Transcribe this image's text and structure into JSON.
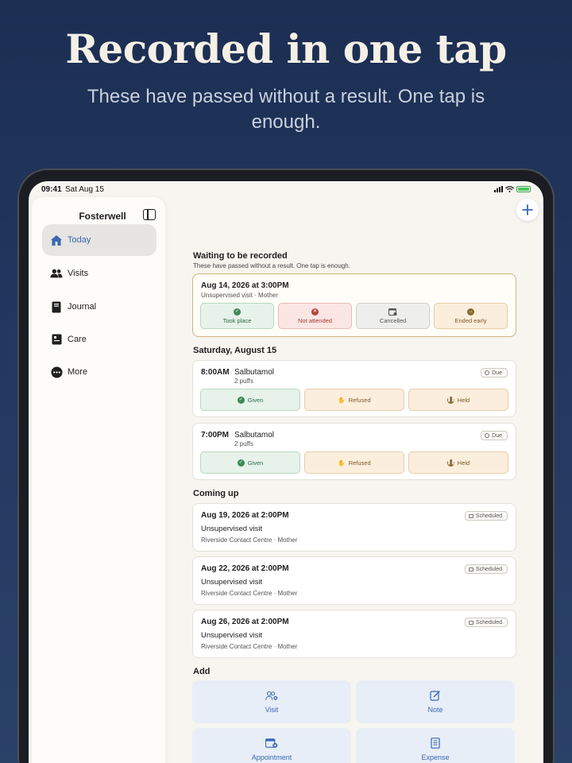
{
  "hero": {
    "title": "Recorded in one tap",
    "subtitle": "These have passed without a result. One tap is enough."
  },
  "status_bar": {
    "time": "09:41",
    "date": "Sat Aug 15"
  },
  "sidebar": {
    "title": "Fosterwell",
    "items": [
      {
        "label": "Today",
        "icon": "house-icon",
        "active": true
      },
      {
        "label": "Visits",
        "icon": "people-icon",
        "active": false
      },
      {
        "label": "Journal",
        "icon": "book-icon",
        "active": false
      },
      {
        "label": "Care",
        "icon": "care-card-icon",
        "active": false
      },
      {
        "label": "More",
        "icon": "ellipsis-icon",
        "active": false
      }
    ]
  },
  "waiting": {
    "title": "Waiting to be recorded",
    "subtitle": "These have passed without a result. One tap is enough.",
    "card": {
      "title": "Aug 14, 2026 at 3:00PM",
      "subtitle": "Unsupervised visit · Mother",
      "actions": [
        "Took place",
        "Not attended",
        "Cancelled",
        "Ended early"
      ]
    }
  },
  "day": {
    "title": "Saturday, August 15",
    "meds": [
      {
        "time": "8:00AM",
        "name": "Salbutamol",
        "dose": "2 puffs",
        "badge": "Due",
        "actions": [
          "Given",
          "Refused",
          "Held"
        ]
      },
      {
        "time": "7:00PM",
        "name": "Salbutamol",
        "dose": "2 puffs",
        "badge": "Due",
        "actions": [
          "Given",
          "Refused",
          "Held"
        ]
      }
    ]
  },
  "coming_up": {
    "title": "Coming up",
    "items": [
      {
        "date": "Aug 19, 2026 at 2:00PM",
        "type": "Unsupervised visit",
        "location": "Riverside Contact Centre · Mother",
        "badge": "Scheduled"
      },
      {
        "date": "Aug 22, 2026 at 2:00PM",
        "type": "Unsupervised visit",
        "location": "Riverside Contact Centre · Mother",
        "badge": "Scheduled"
      },
      {
        "date": "Aug 26, 2026 at 2:00PM",
        "type": "Unsupervised visit",
        "location": "Riverside Contact Centre · Mother",
        "badge": "Scheduled"
      }
    ]
  },
  "add": {
    "title": "Add",
    "buttons": [
      {
        "label": "Visit",
        "icon": "add-person-icon"
      },
      {
        "label": "Note",
        "icon": "edit-note-icon"
      },
      {
        "label": "Appointment",
        "icon": "calendar-add-icon"
      },
      {
        "label": "Expense",
        "icon": "receipt-icon"
      }
    ]
  },
  "colors": {
    "accent": "#3a68b2",
    "background": "#1c2e52",
    "highlight_border": "#d1b382"
  }
}
